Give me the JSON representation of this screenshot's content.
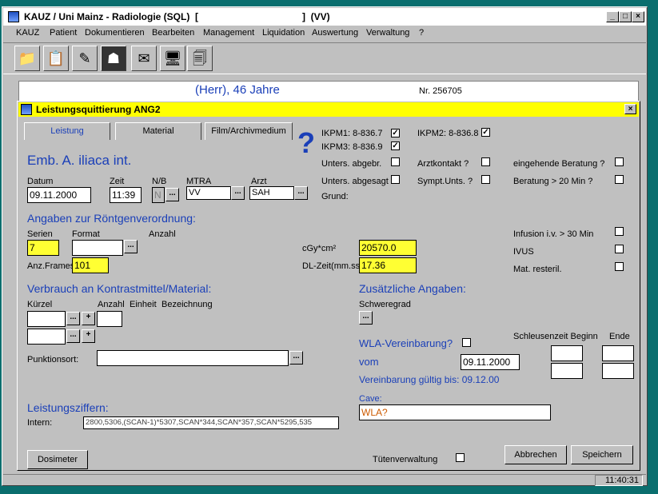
{
  "window": {
    "title": "KAUZ / Uni Mainz - Radiologie (SQL)  [                                       ]  (VV)",
    "controls": {
      "minimize": "_",
      "maximize": "□",
      "close": "×"
    }
  },
  "menu": {
    "kauz": "KAUZ",
    "patient": "Patient",
    "dokumentieren": "Dokumentieren",
    "bearbeiten": "Bearbeiten",
    "management": "Management",
    "liquidation": "Liquidation",
    "auswertung": "Auswertung",
    "verwaltung": "Verwaltung",
    "help": "?"
  },
  "toolbar_icons": [
    "new-folder-icon",
    "form-icon",
    "edit-icon",
    "xray-icon",
    "envelope-icon",
    "computer-icon",
    "documents-icon"
  ],
  "background_window": {
    "patient_info": "(Herr), 46 Jahre",
    "number": "Nr. 256705"
  },
  "dialog": {
    "title": "Leistungsquittierung ANG2",
    "close": "×",
    "tabs": [
      "Leistung",
      "Material",
      "Film/Archivmedium"
    ],
    "help_glyph": "?",
    "exam_title": "Emb. A. iliaca int.",
    "labels": {
      "datum": "Datum",
      "zeit": "Zeit",
      "nb": "N/B",
      "mtra": "MTRA",
      "arzt": "Arzt",
      "ikpm1": "IKPM1: 8-836.7",
      "ikpm2": "IKPM2: 8-836.8",
      "ikpm3": "IKPM3: 8-836.9",
      "unters_abgebr": "Unters. abgebr.",
      "arztkontakt": "Arztkontakt ?",
      "eingehende": "eingehende Beratung ?",
      "unters_abgesagt": "Unters. abgesagt",
      "sympt": "Sympt.Unts. ?",
      "beratung20": "Beratung > 20 Min ?",
      "grund": "Grund:",
      "roentgen": "Angaben zur Röntgenverordnung:",
      "serien": "Serien",
      "format": "Format",
      "anzahl": "Anzahl",
      "cgy": "cGy*cm²",
      "anz_frames": "Anz.Frames",
      "dl_zeit": "DL-Zeit(mm.ss)",
      "infusion": "Infusion i.v. > 30 Min",
      "ivus": "IVUS",
      "mat_resteril": "Mat. resteril.",
      "verbrauch": "Verbrauch an Kontrastmittel/Material:",
      "kuerzel": "Kürzel",
      "anzahl2": "Anzahl",
      "einheit": "Einheit",
      "bezeichnung": "Bezeichnung",
      "zusaetzliche": "Zusätzliche Angaben:",
      "schweregrad": "Schweregrad",
      "wla": "WLA-Vereinbarung?",
      "vom": "vom",
      "gueltig": "Vereinbarung gültig bis: 09.12.00",
      "schleusenzeit": "Schleusenzeit Beginn",
      "ende": "Ende",
      "punktionsort": "Punktionsort:",
      "cave": "Cave:",
      "leistungsziffern": "Leistungsziffern:",
      "intern": "Intern:",
      "tueten": "Tütenverwaltung"
    },
    "values": {
      "datum": "09.11.2000",
      "zeit": "11:39",
      "nb": "N",
      "mtra": "VV",
      "arzt": "SAH",
      "serien": "7",
      "format": "",
      "cgy": "20570.0",
      "anz_frames": "101",
      "dl_zeit": "17.36",
      "vom": "09.11.2000",
      "cave": "WLA?",
      "intern": "2800,5306,(SCAN-1)*5307,SCAN*344,SCAN*357,SCAN*5295,535"
    },
    "checkboxes": {
      "ikpm1": true,
      "ikpm2": true,
      "ikpm3": true,
      "unters_abgebr": false,
      "arztkontakt": false,
      "eingehende": false,
      "unters_abgesagt": false,
      "sympt": false,
      "beratung20": false,
      "infusion": false,
      "ivus": false,
      "mat_resteril": false,
      "wla": false,
      "tueten": false
    },
    "buttons": {
      "dots": "...",
      "plus": "+",
      "dosimeter": "Dosimeter",
      "abbrechen": "Abbrechen",
      "speichern": "Speichern"
    }
  },
  "status": {
    "clock": "11:40:31"
  }
}
